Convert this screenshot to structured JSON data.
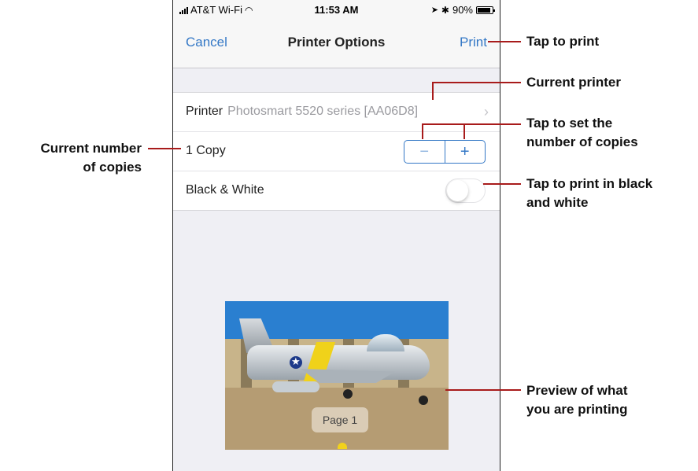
{
  "status_bar": {
    "carrier": "AT&T Wi-Fi",
    "time": "11:53 AM",
    "battery": "90%"
  },
  "nav": {
    "cancel": "Cancel",
    "title": "Printer Options",
    "print": "Print"
  },
  "options": {
    "printer_label": "Printer",
    "printer_value": "Photosmart 5520 series [AA06D8]",
    "copies": "1 Copy",
    "black_white": "Black & White",
    "black_white_on": false,
    "minus": "−",
    "plus": "+"
  },
  "preview": {
    "page_label": "Page 1"
  },
  "callouts": {
    "tap_to_print": "Tap to print",
    "current_printer": "Current printer",
    "set_copies_1": "Tap to set the",
    "set_copies_2": "number of copies",
    "current_copies_1": "Current number",
    "current_copies_2": "of copies",
    "bw_1": "Tap to print in black",
    "bw_2": "and white",
    "preview_1": "Preview of what",
    "preview_2": "you are printing"
  },
  "colors": {
    "ios_blue": "#3478c6",
    "callout_line": "#a81b1b"
  }
}
